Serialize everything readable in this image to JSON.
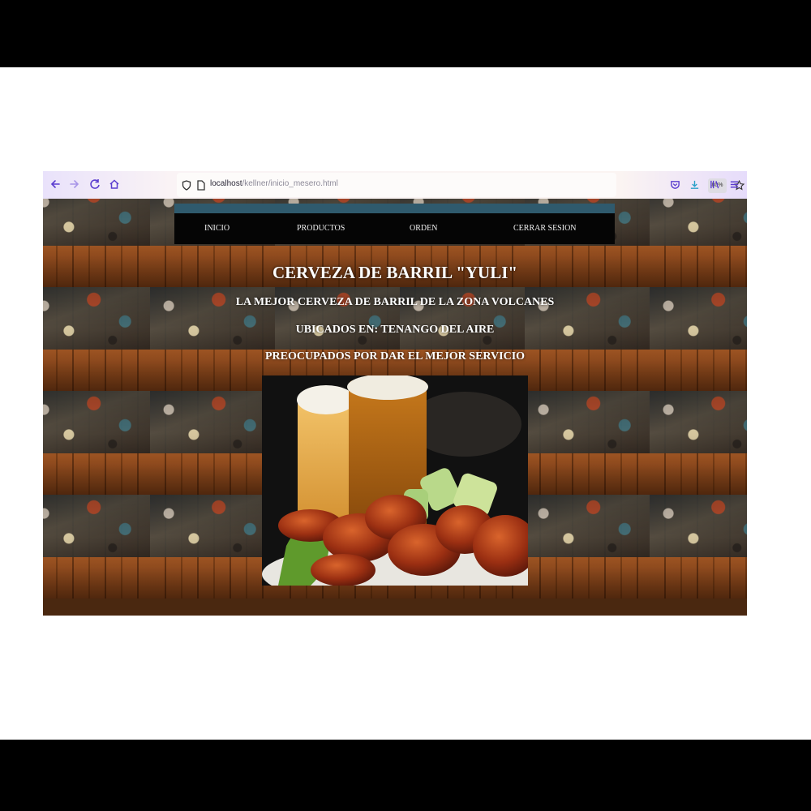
{
  "browser": {
    "url_host": "localhost",
    "url_path": "/kellner/inicio_mesero.html",
    "zoom": "80%",
    "icons": [
      "back-icon",
      "forward-icon",
      "reload-icon",
      "home-icon",
      "shield-icon",
      "page-icon",
      "star-icon",
      "pocket-icon",
      "download-icon",
      "library-icon",
      "menu-icon"
    ]
  },
  "nav": {
    "items": [
      "INICIO",
      "PRODUCTOS",
      "ORDEN",
      "CERRAR SESION"
    ]
  },
  "hero": {
    "title": "CERVEZA DE BARRIL \"YULI\"",
    "line1": "LA MEJOR CERVEZA DE BARRIL DE LA ZONA VOLCANES",
    "line2": "UBICADOS EN: TENANGO DEL AIRE",
    "line3": "PREOCUPADOS POR DAR EL MEJOR SERVICIO"
  },
  "colors": {
    "nav_bar": "#050505",
    "nav_stripe": "#2f5a6d",
    "toolbar_accent": "#5a3ccf"
  }
}
